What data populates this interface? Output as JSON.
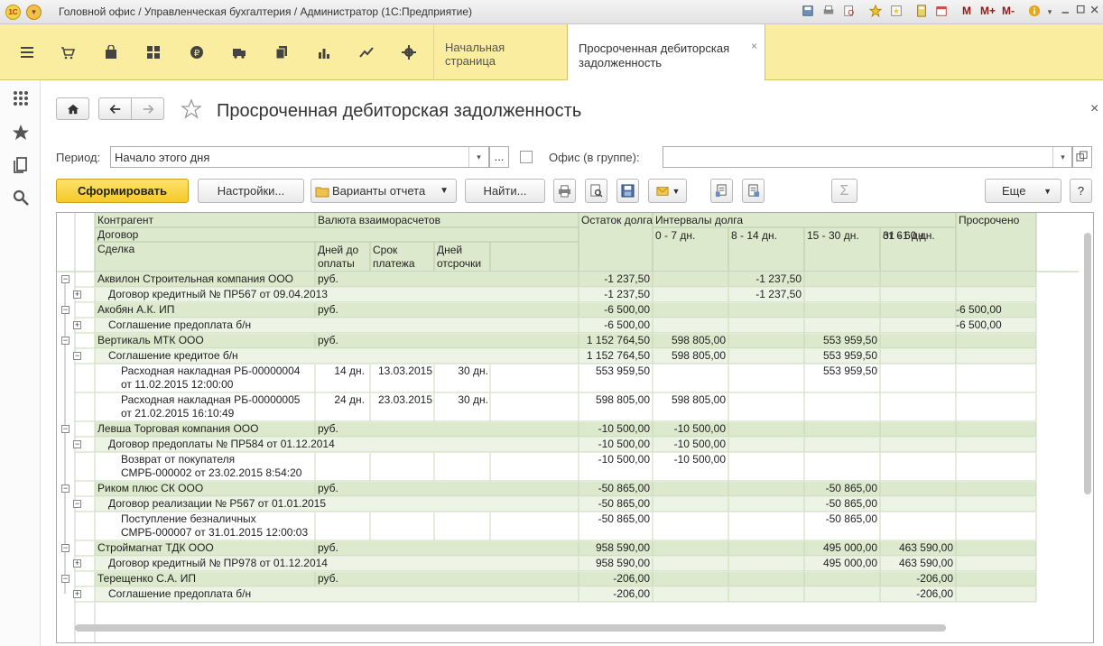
{
  "app": {
    "window_title": "Головной офис / Управленческая бухгалтерия / Администратор  (1С:Предприятие)",
    "logo_text": "1С",
    "title_buttons": [
      "M",
      "M+",
      "M-"
    ]
  },
  "sections": [
    "menu",
    "cart",
    "bag",
    "grid",
    "currency",
    "truck",
    "docs",
    "chart",
    "trend",
    "settings"
  ],
  "tabs": [
    {
      "label": "Начальная страница"
    },
    {
      "label": "Просроченная дебиторская задолженность",
      "close": "×"
    }
  ],
  "form": {
    "title": "Просроченная дебиторская задолженность",
    "close": "×",
    "period_label": "Период:",
    "period_value": "Начало этого дня",
    "office_label": "Офис (в группе):",
    "office_value": "",
    "ellipsis": "...",
    "buttons": {
      "generate": "Сформировать",
      "settings": "Настройки...",
      "variants": "Варианты отчета",
      "find": "Найти...",
      "more": "Еще",
      "help": "?",
      "sigma": "Σ"
    }
  },
  "report": {
    "headers": {
      "contragent": "Контрагент",
      "contract": "Договор",
      "deal": "Сделка",
      "currency": "Валюта взаиморасчетов",
      "days_to_pay": "Дней до оплаты",
      "pay_date": "Срок платежа",
      "delay_days": "Дней отсрочки",
      "balance": "Остаток долга",
      "intervals": "Интервалы долга",
      "i1": "0 - 7 дн.",
      "i2": "8 - 14 дн.",
      "i3": "15 - 30 дн.",
      "i4": "31 - 60 дн.",
      "i5": "от 61 дн.",
      "overdue": "Просрочено"
    },
    "rows": [
      {
        "level": 0,
        "toggle": "−",
        "name": "Аквилон Строительная компания ООО",
        "currency": "руб.",
        "balance": "-1 237,50",
        "i2": "-1 237,50"
      },
      {
        "level": 1,
        "toggle": "+",
        "name": "Договор кредитный № ПР567 от 09.04.2013",
        "balance": "-1 237,50",
        "i2": "-1 237,50"
      },
      {
        "level": 0,
        "toggle": "−",
        "name": "Акобян А.К. ИП",
        "currency": "руб.",
        "balance": "-6 500,00",
        "i5": "-6 500,00"
      },
      {
        "level": 1,
        "toggle": "+",
        "name": "Соглашение предоплата б/н",
        "balance": "-6 500,00",
        "i5": "-6 500,00"
      },
      {
        "level": 0,
        "toggle": "−",
        "name": "Вертикаль МТК ООО",
        "currency": "руб.",
        "balance": "1 152 764,50",
        "i1": "598 805,00",
        "i3": "553 959,50"
      },
      {
        "level": 1,
        "toggle": "−",
        "name": "Соглашение кредитое б/н",
        "balance": "1 152 764,50",
        "i1": "598 805,00",
        "i3": "553 959,50"
      },
      {
        "level": 2,
        "name": "Расходная накладная РБ-00000004",
        "name2": "от 11.02.2015 12:00:00",
        "days": "14 дн.",
        "date": "13.03.2015",
        "delay": "30 дн.",
        "balance": "553 959,50",
        "i3": "553 959,50"
      },
      {
        "level": 2,
        "name": "Расходная накладная РБ-00000005",
        "name2": "от 21.02.2015 16:10:49",
        "days": "24 дн.",
        "date": "23.03.2015",
        "delay": "30 дн.",
        "balance": "598 805,00",
        "i1": "598 805,00"
      },
      {
        "level": 0,
        "toggle": "−",
        "name": "Левша Торговая компания ООО",
        "currency": "руб.",
        "balance": "-10 500,00",
        "i1": "-10 500,00"
      },
      {
        "level": 1,
        "toggle": "−",
        "name": "Договор предоплаты № ПР584 от 01.12.2014",
        "balance": "-10 500,00",
        "i1": "-10 500,00"
      },
      {
        "level": 2,
        "name": "Возврат от покупателя",
        "name2": "СМРБ-000002 от 23.02.2015 8:54:20",
        "balance": "-10 500,00",
        "i1": "-10 500,00"
      },
      {
        "level": 0,
        "toggle": "−",
        "name": "Риком плюс СК ООО",
        "currency": "руб.",
        "balance": "-50 865,00",
        "i3": "-50 865,00"
      },
      {
        "level": 1,
        "toggle": "−",
        "name": "Договор реализации № Р567 от 01.01.2015",
        "balance": "-50 865,00",
        "i3": "-50 865,00"
      },
      {
        "level": 2,
        "name": "Поступление безналичных",
        "name2": "СМРБ-000007 от 31.01.2015 12:00:03",
        "balance": "-50 865,00",
        "i3": "-50 865,00"
      },
      {
        "level": 0,
        "toggle": "−",
        "name": "Строймагнат ТДК ООО",
        "currency": "руб.",
        "balance": "958 590,00",
        "i3": "495 000,00",
        "i4": "463 590,00"
      },
      {
        "level": 1,
        "toggle": "+",
        "name": "Договор кредитный № ПР978 от 01.12.2014",
        "balance": "958 590,00",
        "i3": "495 000,00",
        "i4": "463 590,00"
      },
      {
        "level": 0,
        "toggle": "−",
        "name": "Терещенко С.А. ИП",
        "currency": "руб.",
        "balance": "-206,00",
        "i4": "-206,00"
      },
      {
        "level": 1,
        "toggle": "+",
        "name": "Соглашение предоплата б/н",
        "balance": "-206,00",
        "i4": "-206,00"
      }
    ]
  }
}
